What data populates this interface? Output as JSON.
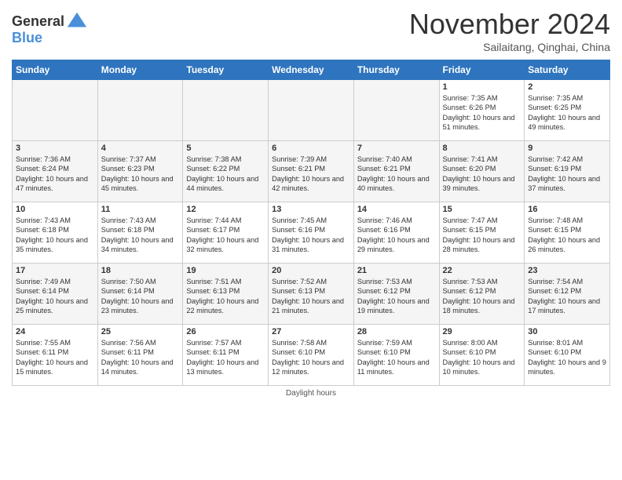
{
  "logo": {
    "line1": "General",
    "line2": "Blue"
  },
  "title": "November 2024",
  "subtitle": "Sailaitang, Qinghai, China",
  "columns": [
    "Sunday",
    "Monday",
    "Tuesday",
    "Wednesday",
    "Thursday",
    "Friday",
    "Saturday"
  ],
  "weeks": [
    [
      {
        "day": "",
        "info": ""
      },
      {
        "day": "",
        "info": ""
      },
      {
        "day": "",
        "info": ""
      },
      {
        "day": "",
        "info": ""
      },
      {
        "day": "",
        "info": ""
      },
      {
        "day": "1",
        "info": "Sunrise: 7:35 AM\nSunset: 6:26 PM\nDaylight: 10 hours and 51 minutes."
      },
      {
        "day": "2",
        "info": "Sunrise: 7:35 AM\nSunset: 6:25 PM\nDaylight: 10 hours and 49 minutes."
      }
    ],
    [
      {
        "day": "3",
        "info": "Sunrise: 7:36 AM\nSunset: 6:24 PM\nDaylight: 10 hours and 47 minutes."
      },
      {
        "day": "4",
        "info": "Sunrise: 7:37 AM\nSunset: 6:23 PM\nDaylight: 10 hours and 45 minutes."
      },
      {
        "day": "5",
        "info": "Sunrise: 7:38 AM\nSunset: 6:22 PM\nDaylight: 10 hours and 44 minutes."
      },
      {
        "day": "6",
        "info": "Sunrise: 7:39 AM\nSunset: 6:21 PM\nDaylight: 10 hours and 42 minutes."
      },
      {
        "day": "7",
        "info": "Sunrise: 7:40 AM\nSunset: 6:21 PM\nDaylight: 10 hours and 40 minutes."
      },
      {
        "day": "8",
        "info": "Sunrise: 7:41 AM\nSunset: 6:20 PM\nDaylight: 10 hours and 39 minutes."
      },
      {
        "day": "9",
        "info": "Sunrise: 7:42 AM\nSunset: 6:19 PM\nDaylight: 10 hours and 37 minutes."
      }
    ],
    [
      {
        "day": "10",
        "info": "Sunrise: 7:43 AM\nSunset: 6:18 PM\nDaylight: 10 hours and 35 minutes."
      },
      {
        "day": "11",
        "info": "Sunrise: 7:43 AM\nSunset: 6:18 PM\nDaylight: 10 hours and 34 minutes."
      },
      {
        "day": "12",
        "info": "Sunrise: 7:44 AM\nSunset: 6:17 PM\nDaylight: 10 hours and 32 minutes."
      },
      {
        "day": "13",
        "info": "Sunrise: 7:45 AM\nSunset: 6:16 PM\nDaylight: 10 hours and 31 minutes."
      },
      {
        "day": "14",
        "info": "Sunrise: 7:46 AM\nSunset: 6:16 PM\nDaylight: 10 hours and 29 minutes."
      },
      {
        "day": "15",
        "info": "Sunrise: 7:47 AM\nSunset: 6:15 PM\nDaylight: 10 hours and 28 minutes."
      },
      {
        "day": "16",
        "info": "Sunrise: 7:48 AM\nSunset: 6:15 PM\nDaylight: 10 hours and 26 minutes."
      }
    ],
    [
      {
        "day": "17",
        "info": "Sunrise: 7:49 AM\nSunset: 6:14 PM\nDaylight: 10 hours and 25 minutes."
      },
      {
        "day": "18",
        "info": "Sunrise: 7:50 AM\nSunset: 6:14 PM\nDaylight: 10 hours and 23 minutes."
      },
      {
        "day": "19",
        "info": "Sunrise: 7:51 AM\nSunset: 6:13 PM\nDaylight: 10 hours and 22 minutes."
      },
      {
        "day": "20",
        "info": "Sunrise: 7:52 AM\nSunset: 6:13 PM\nDaylight: 10 hours and 21 minutes."
      },
      {
        "day": "21",
        "info": "Sunrise: 7:53 AM\nSunset: 6:12 PM\nDaylight: 10 hours and 19 minutes."
      },
      {
        "day": "22",
        "info": "Sunrise: 7:53 AM\nSunset: 6:12 PM\nDaylight: 10 hours and 18 minutes."
      },
      {
        "day": "23",
        "info": "Sunrise: 7:54 AM\nSunset: 6:12 PM\nDaylight: 10 hours and 17 minutes."
      }
    ],
    [
      {
        "day": "24",
        "info": "Sunrise: 7:55 AM\nSunset: 6:11 PM\nDaylight: 10 hours and 15 minutes."
      },
      {
        "day": "25",
        "info": "Sunrise: 7:56 AM\nSunset: 6:11 PM\nDaylight: 10 hours and 14 minutes."
      },
      {
        "day": "26",
        "info": "Sunrise: 7:57 AM\nSunset: 6:11 PM\nDaylight: 10 hours and 13 minutes."
      },
      {
        "day": "27",
        "info": "Sunrise: 7:58 AM\nSunset: 6:10 PM\nDaylight: 10 hours and 12 minutes."
      },
      {
        "day": "28",
        "info": "Sunrise: 7:59 AM\nSunset: 6:10 PM\nDaylight: 10 hours and 11 minutes."
      },
      {
        "day": "29",
        "info": "Sunrise: 8:00 AM\nSunset: 6:10 PM\nDaylight: 10 hours and 10 minutes."
      },
      {
        "day": "30",
        "info": "Sunrise: 8:01 AM\nSunset: 6:10 PM\nDaylight: 10 hours and 9 minutes."
      }
    ]
  ],
  "footer": "Daylight hours"
}
